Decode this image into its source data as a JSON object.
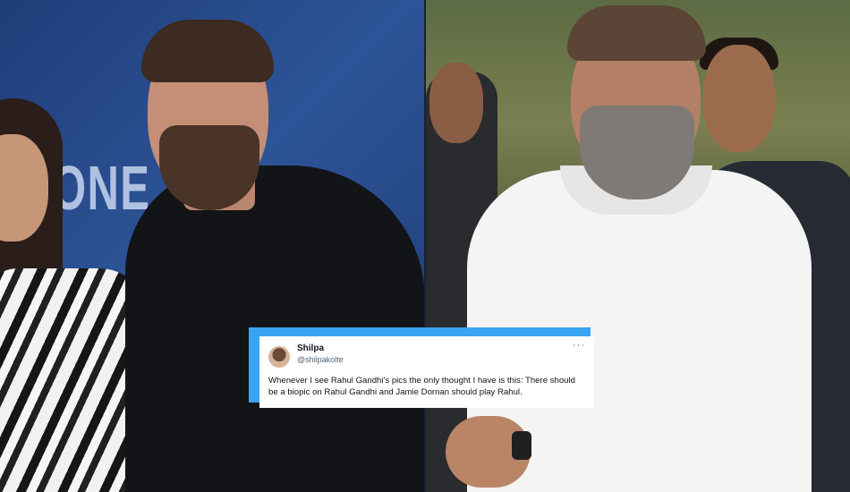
{
  "tweet": {
    "display_name": "Shilpa",
    "handle": "@shilpakolte",
    "text": "Whenever I see Rahul Gandhi's pics the only thought I have is this: There should be a biopic on Rahul Gandhi and Jamie Dornan should play Rahul.",
    "more_icon": "···"
  },
  "photo_left": {
    "backdrop_text": "ONE"
  },
  "colors": {
    "accent": "#3aa3f0",
    "card_bg": "#ffffff",
    "text_primary": "#0f1419",
    "text_secondary": "#536471"
  }
}
